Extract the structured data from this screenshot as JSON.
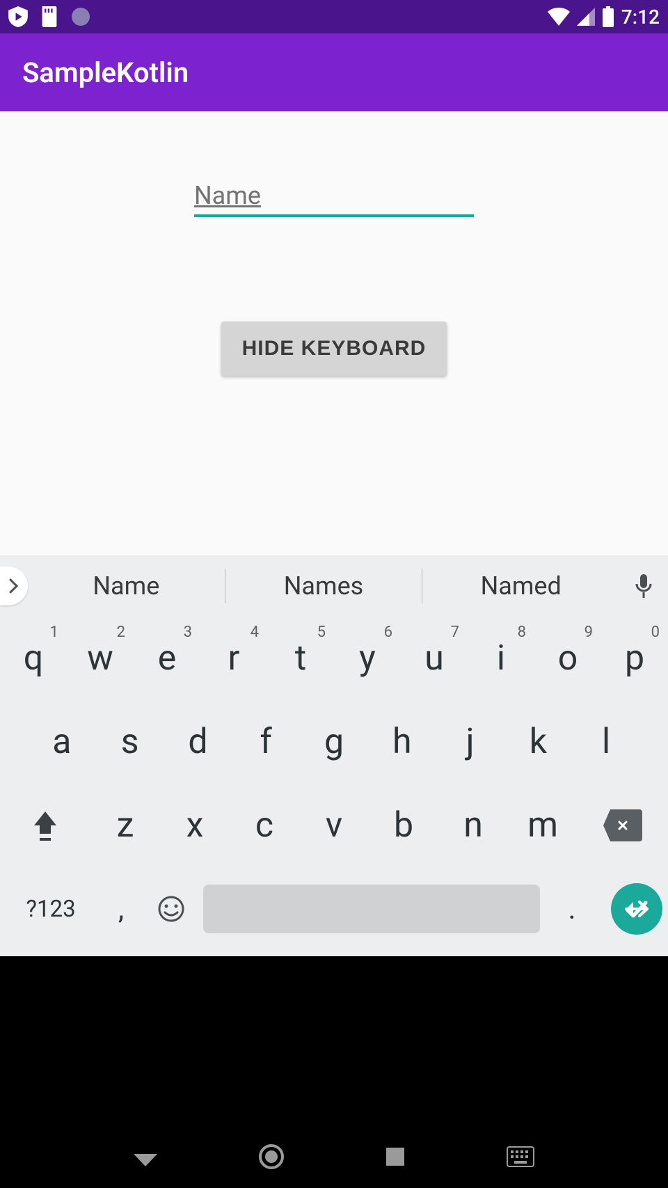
{
  "status": {
    "time": "7:12"
  },
  "app": {
    "title": "SampleKotlin"
  },
  "form": {
    "name_hint": "Name",
    "button_label": "HIDE KEYBOARD"
  },
  "keyboard": {
    "suggestions": [
      "Name",
      "Names",
      "Named"
    ],
    "row1": [
      {
        "k": "q",
        "n": "1"
      },
      {
        "k": "w",
        "n": "2"
      },
      {
        "k": "e",
        "n": "3"
      },
      {
        "k": "r",
        "n": "4"
      },
      {
        "k": "t",
        "n": "5"
      },
      {
        "k": "y",
        "n": "6"
      },
      {
        "k": "u",
        "n": "7"
      },
      {
        "k": "i",
        "n": "8"
      },
      {
        "k": "o",
        "n": "9"
      },
      {
        "k": "p",
        "n": "0"
      }
    ],
    "row2": [
      "a",
      "s",
      "d",
      "f",
      "g",
      "h",
      "j",
      "k",
      "l"
    ],
    "row3": [
      "z",
      "x",
      "c",
      "v",
      "b",
      "n",
      "m"
    ],
    "sym_label": "?123",
    "comma": ",",
    "period": "."
  }
}
